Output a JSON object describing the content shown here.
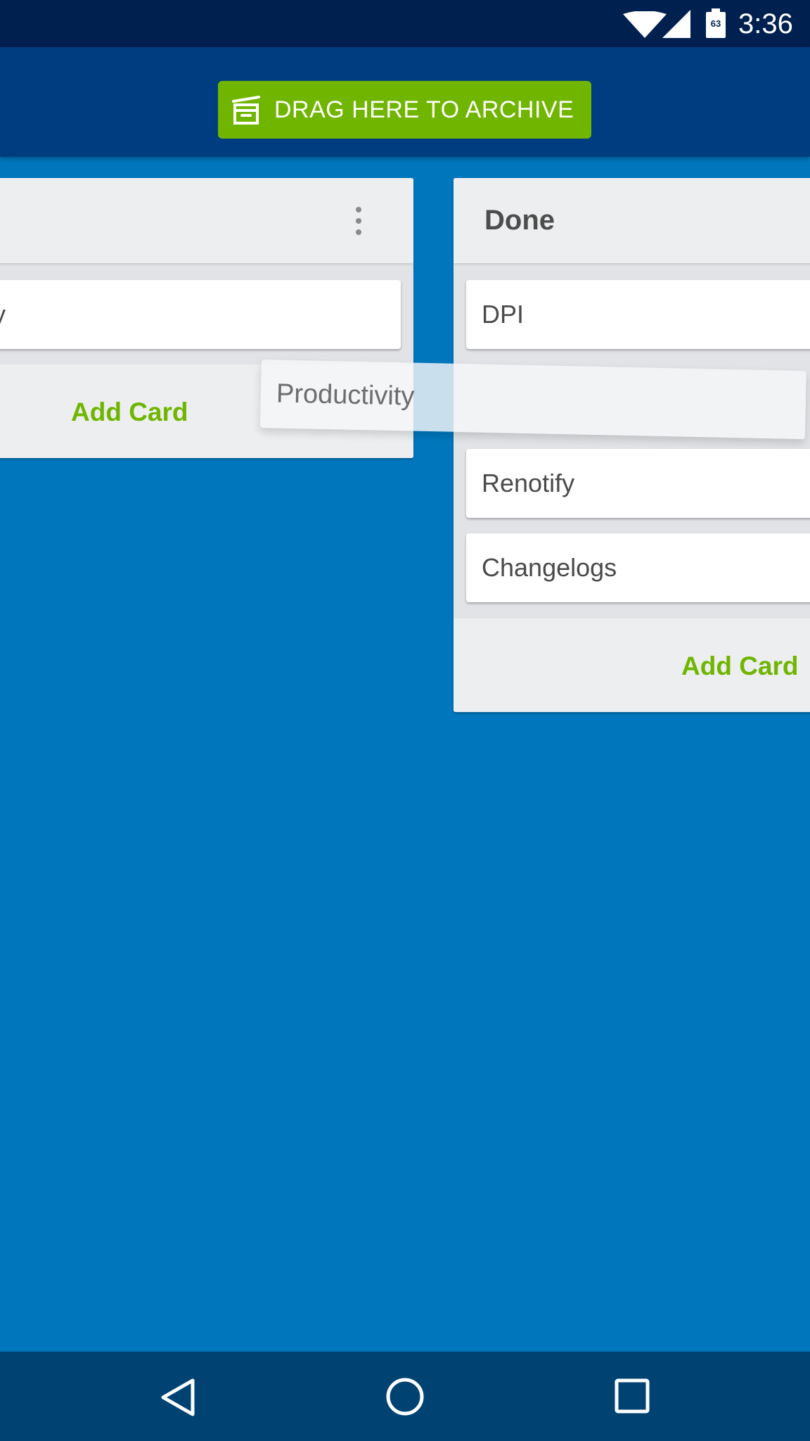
{
  "status_bar": {
    "time": "3:36",
    "battery_level": "63",
    "icons": [
      "wifi-icon",
      "signal-icon",
      "battery-icon"
    ]
  },
  "top_bar": {
    "archive_label": "DRAG HERE TO ARCHIVE",
    "archive_icon": "archive-box-icon",
    "archive_color": "#70b500"
  },
  "lists": [
    {
      "title": "",
      "menu_icon": "overflow-menu-icon",
      "cards": [
        {
          "label": "ty"
        }
      ],
      "add_card_label": "Add Card"
    },
    {
      "title": "Done",
      "cards": [
        {
          "label": "DPI"
        },
        {
          "label": "Renotify"
        },
        {
          "label": "Changelogs"
        }
      ],
      "add_card_label": "Add Card"
    }
  ],
  "dragging_card": {
    "label": "Productivity"
  },
  "nav_bar": {
    "icons": [
      "back-icon",
      "home-icon",
      "recents-icon"
    ]
  },
  "colors": {
    "board_background": "#0077bd",
    "status_bar": "#002050",
    "top_bar": "#003d80",
    "nav_bar": "#004373",
    "accent_green": "#70b500"
  }
}
